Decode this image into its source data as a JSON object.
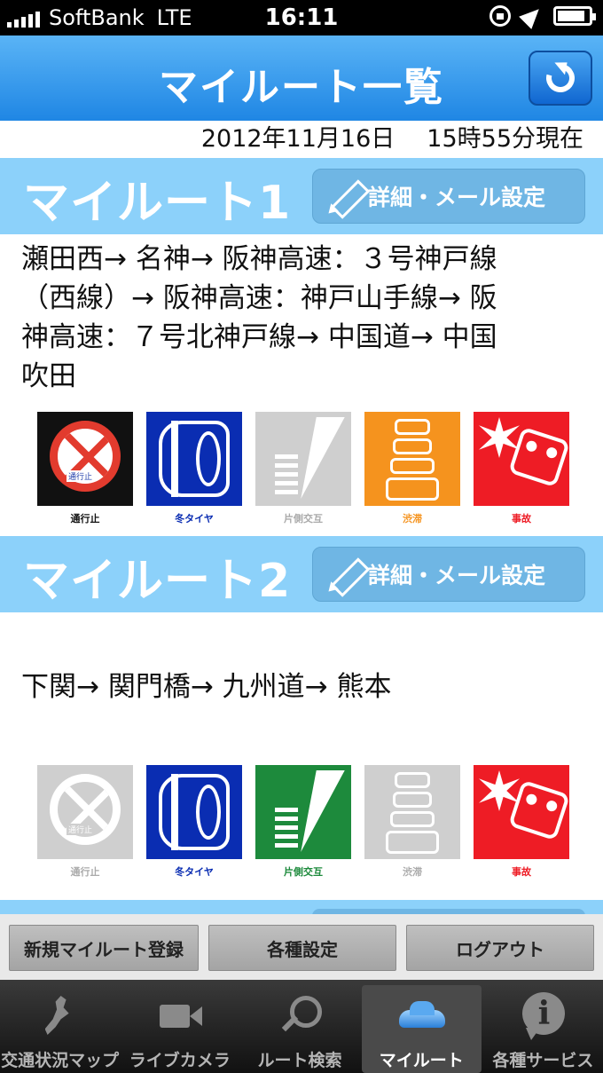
{
  "status_bar": {
    "carrier": "SoftBank",
    "network": "LTE",
    "time": "16:11",
    "icons": [
      "signal-icon",
      "rotation-lock-icon",
      "location-icon",
      "battery-icon"
    ]
  },
  "nav": {
    "title": "マイルート一覧",
    "refresh_icon": "refresh-icon"
  },
  "datetime": {
    "date": "2012年11月16日",
    "time": "15時55分現在"
  },
  "routes": [
    {
      "title": "マイルート1",
      "detail_button": "詳細・メール設定",
      "path_lines": [
        "瀬田西→ 名神→ 阪神高速：３号神戸線",
        "（西線）→ 阪神高速：神戸山手線→ 阪",
        "神高速：７号北神戸線→ 中国道→ 中国",
        "吹田"
      ],
      "status_icons": [
        {
          "label": "通行止",
          "active": true,
          "sign_text": "通行止"
        },
        {
          "label": "冬タイヤ",
          "active": true
        },
        {
          "label": "片側交互",
          "active": false
        },
        {
          "label": "渋滞",
          "active": true
        },
        {
          "label": "事故",
          "active": true
        }
      ]
    },
    {
      "title": "マイルート2",
      "detail_button": "詳細・メール設定",
      "path_lines": [
        "下関→ 関門橋→ 九州道→ 熊本"
      ],
      "status_icons": [
        {
          "label": "通行止",
          "active": false,
          "sign_text": "通行止"
        },
        {
          "label": "冬タイヤ",
          "active": true
        },
        {
          "label": "片側交互",
          "active": true
        },
        {
          "label": "渋滞",
          "active": false
        },
        {
          "label": "事故",
          "active": true
        }
      ]
    }
  ],
  "actions": {
    "register": "新規マイルート登録",
    "settings": "各種設定",
    "logout": "ログアウト"
  },
  "tabs": [
    {
      "label": "交通状況マップ",
      "icon": "japan-map-icon",
      "active": false
    },
    {
      "label": "ライブカメラ",
      "icon": "video-camera-icon",
      "active": false
    },
    {
      "label": "ルート検索",
      "icon": "magnifier-icon",
      "active": false
    },
    {
      "label": "マイルート",
      "icon": "car-icon",
      "active": true
    },
    {
      "label": "各種サービス",
      "icon": "info-icon",
      "active": false
    }
  ],
  "colors": {
    "nav_blue": "#2a8fe8",
    "section_blue": "#8cd1fa",
    "detail_button": "#6fb6e4",
    "closed": "#111111",
    "winter_tire": "#0a2db2",
    "alternating": "#1d8a3c",
    "congestion": "#f5931e",
    "accident": "#ee1c25",
    "inactive": "#cfcfcf"
  }
}
